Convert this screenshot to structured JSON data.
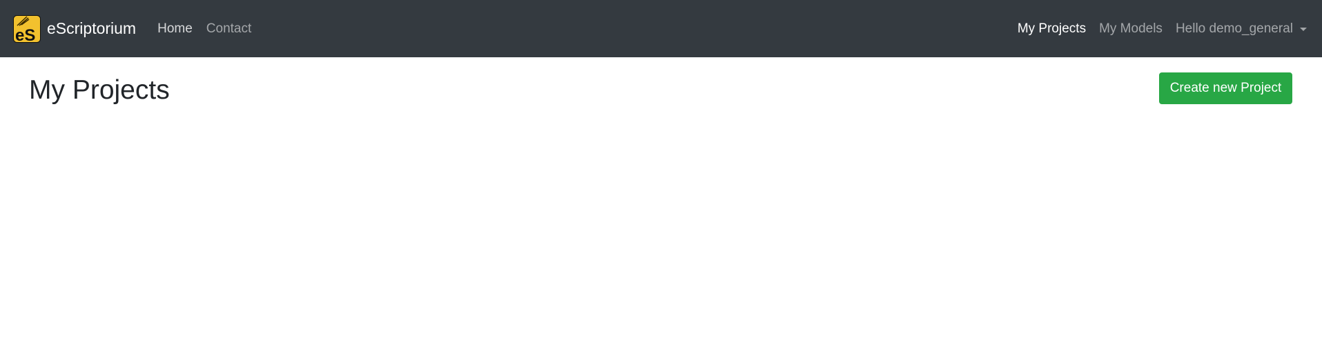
{
  "navbar": {
    "brand": {
      "name": "eScriptorium",
      "logo_letters": "eS",
      "logo_icon": "escriptorium-logo-icon"
    },
    "left_links": [
      {
        "label": "Home"
      },
      {
        "label": "Contact"
      }
    ],
    "right_links": [
      {
        "label": "My Projects",
        "active": true
      },
      {
        "label": "My Models"
      }
    ],
    "user_menu": {
      "label": "Hello demo_general",
      "icon": "caret-down-icon"
    }
  },
  "main": {
    "title": "My Projects",
    "create_button_label": "Create new Project"
  },
  "colors": {
    "navbar_bg": "#343a40",
    "primary_success": "#28a745",
    "logo_yellow": "#f2c12e",
    "title_text": "#212529"
  }
}
